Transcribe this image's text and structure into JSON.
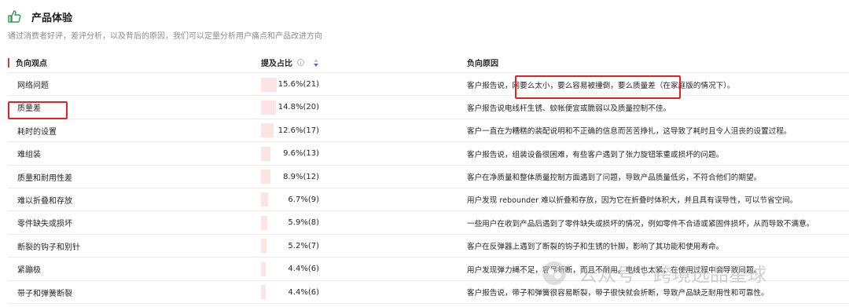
{
  "section": {
    "title": "产品体验",
    "subtitle": "通过消费者好评，差评分析，以及背后的原因，我们可以定量分析用户痛点和产品改进方向",
    "icon": "thumbs-up-icon"
  },
  "table": {
    "headers": {
      "issue": "负向观点",
      "share": "提及占比",
      "reason": "负向原因"
    },
    "rows": [
      {
        "issue": "网络问题",
        "share": "15.6%(21)",
        "ratio": 0.156,
        "reason": "客户报告说，网要么太小，要么容易被撞倒，要么质量差（在家庭版的情况下）。"
      },
      {
        "issue": "质量差",
        "share": "14.8%(20)",
        "ratio": 0.148,
        "reason": "客户报告说电线杆生锈、蚊帐便宜或脆弱以及质量控制不佳。"
      },
      {
        "issue": "耗时的设置",
        "share": "12.6%(17)",
        "ratio": 0.126,
        "reason": "客户一直在为糟糕的装配说明和不正确的信息而苦苦挣扎，这导致了耗时且令人沮丧的设置过程。"
      },
      {
        "issue": "难组装",
        "share": "9.6%(13)",
        "ratio": 0.096,
        "reason": "客户报告说，组装设备很困难，有些客户遇到了张力旋钮笨重或损坏的问题。"
      },
      {
        "issue": "质量和耐用性差",
        "share": "8.9%(12)",
        "ratio": 0.089,
        "reason": "客户在净质量和整体质量控制方面遇到了问题，导致产品质量低劣，不符合他们的期望。"
      },
      {
        "issue": "难以折叠和存放",
        "share": "6.7%(9)",
        "ratio": 0.067,
        "reason": "用户发现 rebounder 难以折叠和存放，因为它在折叠时体积大，并且具有误导性，可以节省空间。"
      },
      {
        "issue": "零件缺失或损坏",
        "share": "5.9%(8)",
        "ratio": 0.059,
        "reason": "一些用户在收到产品后遇到了零件缺失或损坏的情况，例如零件不合适或紧固件损坏，从而导致不满意。"
      },
      {
        "issue": "断裂的钩子和别针",
        "share": "5.2%(7)",
        "ratio": 0.052,
        "reason": "客户在反弹器上遇到了断裂的钩子和生锈的针脚，影响了其功能和使用寿命。"
      },
      {
        "issue": "紧蹦极",
        "share": "4.4%(6)",
        "ratio": 0.044,
        "reason": "用户发现弹力绳不足，容易折断，而且不耐用。电线也太紧，在使用过程中会导致问题。"
      },
      {
        "issue": "带子和弹簧断裂",
        "share": "4.4%(6)",
        "ratio": 0.044,
        "reason": "客户报告说，带子和弹簧很容易断裂，带子很快就会折断，导致产品缺乏耐用性和可靠性。"
      }
    ]
  },
  "watermark": {
    "text": "公众号 · 跨境选品星球",
    "icon": "wechat-icon"
  },
  "colors": {
    "bar_fill": "#fde4e4",
    "highlight_border": "#e8211f",
    "header_mark": "#e53935",
    "sort_active": "#4a6cf7",
    "icon_green": "#2ea44f"
  }
}
